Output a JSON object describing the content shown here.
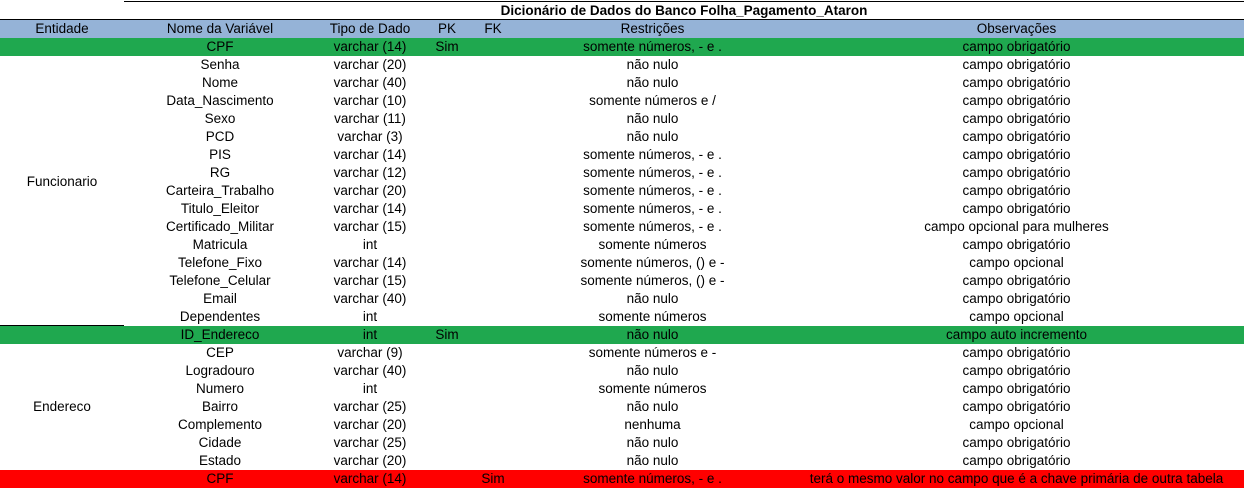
{
  "title": "Dicionário de Dados do Banco Folha_Pagamento_Ataron",
  "headers": {
    "entidade": "Entidade",
    "nome": "Nome da Variável",
    "tipo": "Tipo de Dado",
    "pk": "PK",
    "fk": "FK",
    "restricoes": "Restrições",
    "observacoes": "Observações"
  },
  "colors": {
    "header": "#95b3d7",
    "primary_key_row": "#1fa84f",
    "foreign_key_row": "#ff0000"
  },
  "entities": [
    {
      "name": "Funcionario",
      "rows": [
        {
          "nome": "CPF",
          "tipo": "varchar (14)",
          "pk": "Sim",
          "fk": "",
          "rest": "somente números, - e .",
          "obs": "campo obrigatório",
          "highlight": "green"
        },
        {
          "nome": "Senha",
          "tipo": "varchar (20)",
          "pk": "",
          "fk": "",
          "rest": "não nulo",
          "obs": "campo obrigatório",
          "highlight": ""
        },
        {
          "nome": "Nome",
          "tipo": "varchar (40)",
          "pk": "",
          "fk": "",
          "rest": "não nulo",
          "obs": "campo obrigatório",
          "highlight": ""
        },
        {
          "nome": "Data_Nascimento",
          "tipo": "varchar (10)",
          "pk": "",
          "fk": "",
          "rest": "somente números e /",
          "obs": "campo obrigatório",
          "highlight": ""
        },
        {
          "nome": "Sexo",
          "tipo": "varchar (11)",
          "pk": "",
          "fk": "",
          "rest": "não nulo",
          "obs": "campo obrigatório",
          "highlight": ""
        },
        {
          "nome": "PCD",
          "tipo": "varchar (3)",
          "pk": "",
          "fk": "",
          "rest": "não nulo",
          "obs": "campo obrigatório",
          "highlight": ""
        },
        {
          "nome": "PIS",
          "tipo": "varchar (14)",
          "pk": "",
          "fk": "",
          "rest": "somente números, - e .",
          "obs": "campo obrigatório",
          "highlight": ""
        },
        {
          "nome": "RG",
          "tipo": "varchar (12)",
          "pk": "",
          "fk": "",
          "rest": "somente números, - e .",
          "obs": "campo obrigatório",
          "highlight": ""
        },
        {
          "nome": "Carteira_Trabalho",
          "tipo": "varchar (20)",
          "pk": "",
          "fk": "",
          "rest": "somente números, - e .",
          "obs": "campo obrigatório",
          "highlight": ""
        },
        {
          "nome": "Titulo_Eleitor",
          "tipo": "varchar (14)",
          "pk": "",
          "fk": "",
          "rest": "somente números, - e .",
          "obs": "campo obrigatório",
          "highlight": ""
        },
        {
          "nome": "Certificado_Militar",
          "tipo": "varchar (15)",
          "pk": "",
          "fk": "",
          "rest": "somente números, - e .",
          "obs": "campo opcional para mulheres",
          "highlight": ""
        },
        {
          "nome": "Matricula",
          "tipo": "int",
          "pk": "",
          "fk": "",
          "rest": "somente números",
          "obs": "campo obrigatório",
          "highlight": ""
        },
        {
          "nome": "Telefone_Fixo",
          "tipo": "varchar (14)",
          "pk": "",
          "fk": "",
          "rest": "somente números, () e -",
          "obs": "campo opcional",
          "highlight": ""
        },
        {
          "nome": "Telefone_Celular",
          "tipo": "varchar (15)",
          "pk": "",
          "fk": "",
          "rest": "somente números, () e -",
          "obs": "campo obrigatório",
          "highlight": ""
        },
        {
          "nome": "Email",
          "tipo": "varchar (40)",
          "pk": "",
          "fk": "",
          "rest": "não nulo",
          "obs": "campo obrigatório",
          "highlight": ""
        },
        {
          "nome": "Dependentes",
          "tipo": "int",
          "pk": "",
          "fk": "",
          "rest": "somente números",
          "obs": "campo opcional",
          "highlight": ""
        }
      ]
    },
    {
      "name": "Endereco",
      "rows": [
        {
          "nome": "ID_Endereco",
          "tipo": "int",
          "pk": "Sim",
          "fk": "",
          "rest": "não nulo",
          "obs": "campo auto incremento",
          "highlight": "green"
        },
        {
          "nome": "CEP",
          "tipo": "varchar (9)",
          "pk": "",
          "fk": "",
          "rest": "somente números e -",
          "obs": "campo obrigatório",
          "highlight": ""
        },
        {
          "nome": "Logradouro",
          "tipo": "varchar (40)",
          "pk": "",
          "fk": "",
          "rest": "não nulo",
          "obs": "campo obrigatório",
          "highlight": ""
        },
        {
          "nome": "Numero",
          "tipo": "int",
          "pk": "",
          "fk": "",
          "rest": "somente números",
          "obs": "campo obrigatório",
          "highlight": ""
        },
        {
          "nome": "Bairro",
          "tipo": "varchar (25)",
          "pk": "",
          "fk": "",
          "rest": "não nulo",
          "obs": "campo obrigatório",
          "highlight": ""
        },
        {
          "nome": "Complemento",
          "tipo": "varchar (20)",
          "pk": "",
          "fk": "",
          "rest": "nenhuma",
          "obs": "campo opcional",
          "highlight": ""
        },
        {
          "nome": "Cidade",
          "tipo": "varchar (25)",
          "pk": "",
          "fk": "",
          "rest": "não nulo",
          "obs": "campo obrigatório",
          "highlight": ""
        },
        {
          "nome": "Estado",
          "tipo": "varchar (20)",
          "pk": "",
          "fk": "",
          "rest": "não nulo",
          "obs": "campo obrigatório",
          "highlight": ""
        },
        {
          "nome": "CPF",
          "tipo": "varchar (14)",
          "pk": "",
          "fk": "Sim",
          "rest": "somente números, - e .",
          "obs": "terá o mesmo valor no campo que é a chave primária de outra tabela",
          "highlight": "red"
        }
      ]
    }
  ]
}
